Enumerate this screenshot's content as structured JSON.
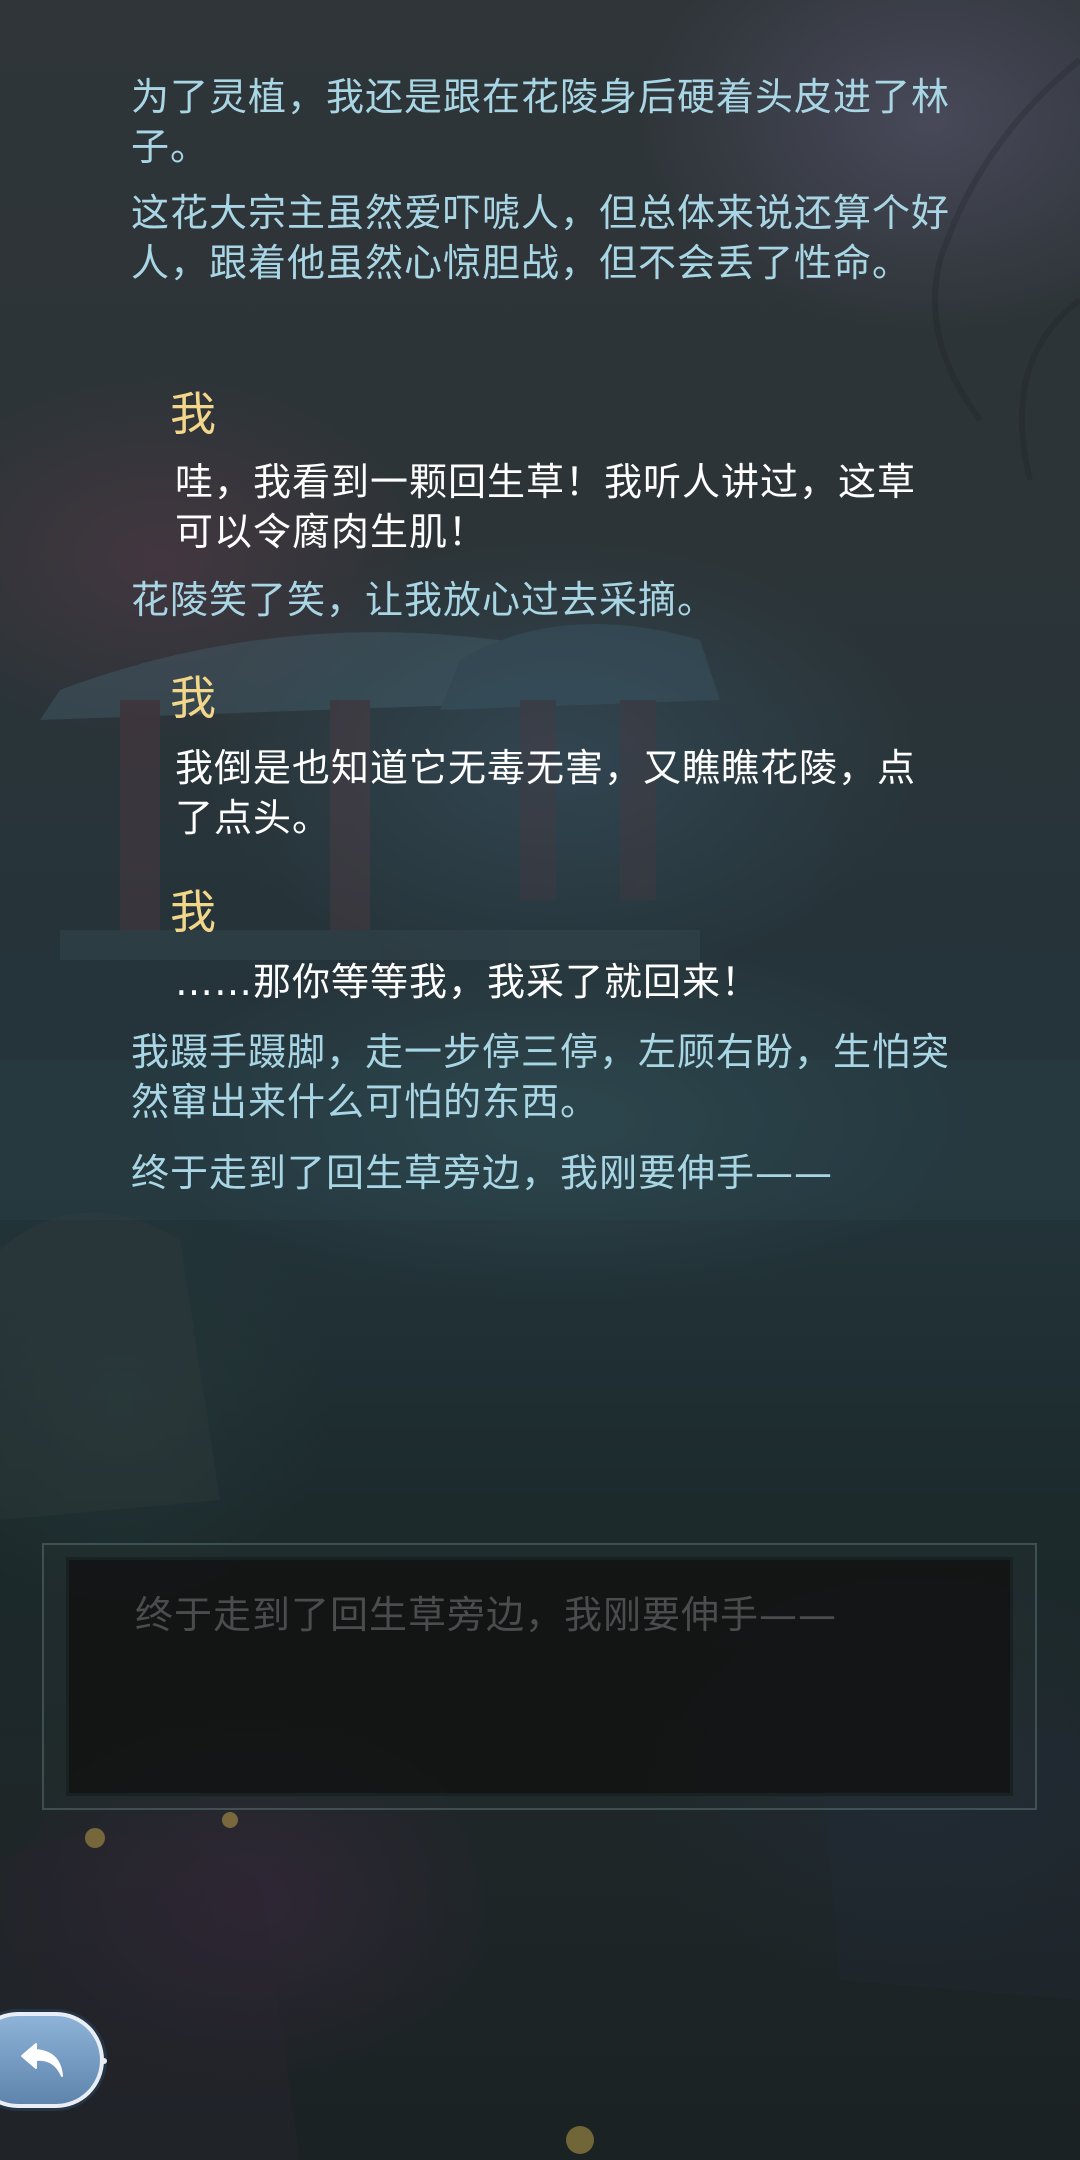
{
  "story": {
    "p1": "为了灵植，我还是跟在花陵身后硬着头皮进了林子。",
    "p2": "这花大宗主虽然爱吓唬人，但总体来说还算个好人，跟着他虽然心惊胆战，但不会丢了性命。",
    "speaker1": "我",
    "d1": "哇，我看到一颗回生草！我听人讲过，这草可以令腐肉生肌！",
    "p3": "花陵笑了笑，让我放心过去采摘。",
    "speaker2": "我",
    "d2": "我倒是也知道它无毒无害，又瞧瞧花陵，点了点头。",
    "speaker3": "我",
    "d3": "……那你等等我，我采了就回来！",
    "p4": "我蹑手蹑脚，走一步停三停，左顾右盼，生怕突然窜出来什么可怕的东西。",
    "p5": "终于走到了回生草旁边，我刚要伸手——"
  },
  "input_box": {
    "text": "终于走到了回生草旁边，我刚要伸手——"
  },
  "controls": {
    "back_icon": "back-arrow-icon"
  },
  "colors": {
    "narration": "#a9d6e5",
    "speaker": "#f2d68a",
    "dialogue": "#ffffff",
    "input_text": "#4a4d4d",
    "back_button": "#7aa0c8"
  }
}
